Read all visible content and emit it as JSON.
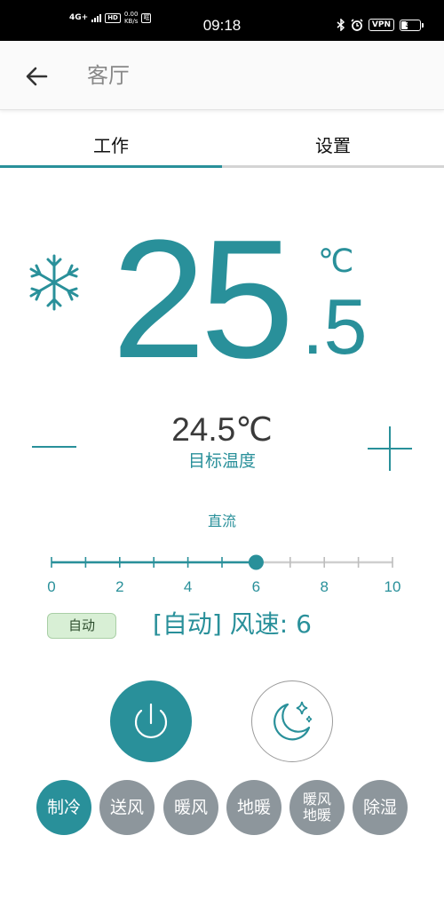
{
  "status_bar": {
    "network": "4G+",
    "hd": "HD",
    "speed_value": "0.00",
    "speed_unit": "KB/s",
    "wifi_badge": "哐",
    "time": "09:18",
    "vpn": "VPN",
    "battery": "37",
    "battery_level": 0.37
  },
  "header": {
    "title": "客厅"
  },
  "tabs": [
    {
      "label": "工作",
      "selected": true
    },
    {
      "label": "设置",
      "selected": false
    }
  ],
  "current_temp": {
    "integer": "25",
    "decimal": ".5",
    "unit": "℃",
    "mode_icon": "snowflake-icon"
  },
  "target_temp": {
    "value": "24.5℃",
    "label": "目标温度"
  },
  "fan": {
    "type_label": "直流",
    "min": 0,
    "max": 10,
    "value": 6,
    "tick_labels": [
      "0",
      "2",
      "4",
      "6",
      "8",
      "10"
    ],
    "auto_chip": "自动",
    "status": "[自动] 风速: 6"
  },
  "modes": [
    {
      "label": "制冷",
      "active": true
    },
    {
      "label": "送风",
      "active": false
    },
    {
      "label": "暖风",
      "active": false
    },
    {
      "label": "地暖",
      "active": false
    },
    {
      "label_line1": "暖风",
      "label_line2": "地暖",
      "active": false
    },
    {
      "label": "除湿",
      "active": false
    }
  ],
  "colors": {
    "accent": "#29909a",
    "inactive_mode": "#8d969c",
    "track_inactive": "#cfcfcf",
    "chip_bg": "#d8efd5"
  }
}
